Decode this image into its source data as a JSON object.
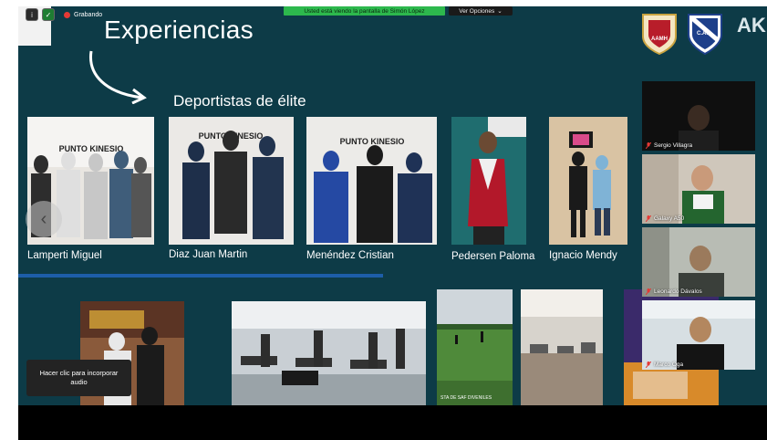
{
  "toolbar": {
    "recording_label": "Grabando",
    "share_banner": "Usted está viendo la pantalla de Simón López",
    "view_options_label": "Ver Opciones",
    "view_options_chevron": "⌄"
  },
  "slide": {
    "title": "Experiencias",
    "subtitle": "Deportistas de élite",
    "logos": {
      "aamh_text": "AAMH",
      "caa_text": "C.A.A.",
      "ak_text": "AK"
    },
    "photos_top": [
      {
        "caption": "Lamperti Miguel"
      },
      {
        "caption": "Diaz Juan Martin"
      },
      {
        "caption": "Menéndez Cristian"
      },
      {
        "caption": "Pedersen Paloma"
      },
      {
        "caption": "Ignacio Mendy"
      }
    ],
    "photo_brand_text": "PUNTO KINESIO",
    "prev_arrow": "‹",
    "video_overlay_text": "STA DE SAF DIVENILES"
  },
  "participants": [
    {
      "name": "Sergio Villagra"
    },
    {
      "name": "Galaxy A50"
    },
    {
      "name": "Leonardo Dávalos"
    },
    {
      "name": "Marco Oga"
    }
  ],
  "tooltip": {
    "text": "Hacer clic para incorporar audio"
  },
  "colors": {
    "slide_bg": "#0d3b47",
    "banner_green": "#2db84d",
    "divider_blue": "#1d5ea8",
    "recording_red": "#e53935"
  }
}
